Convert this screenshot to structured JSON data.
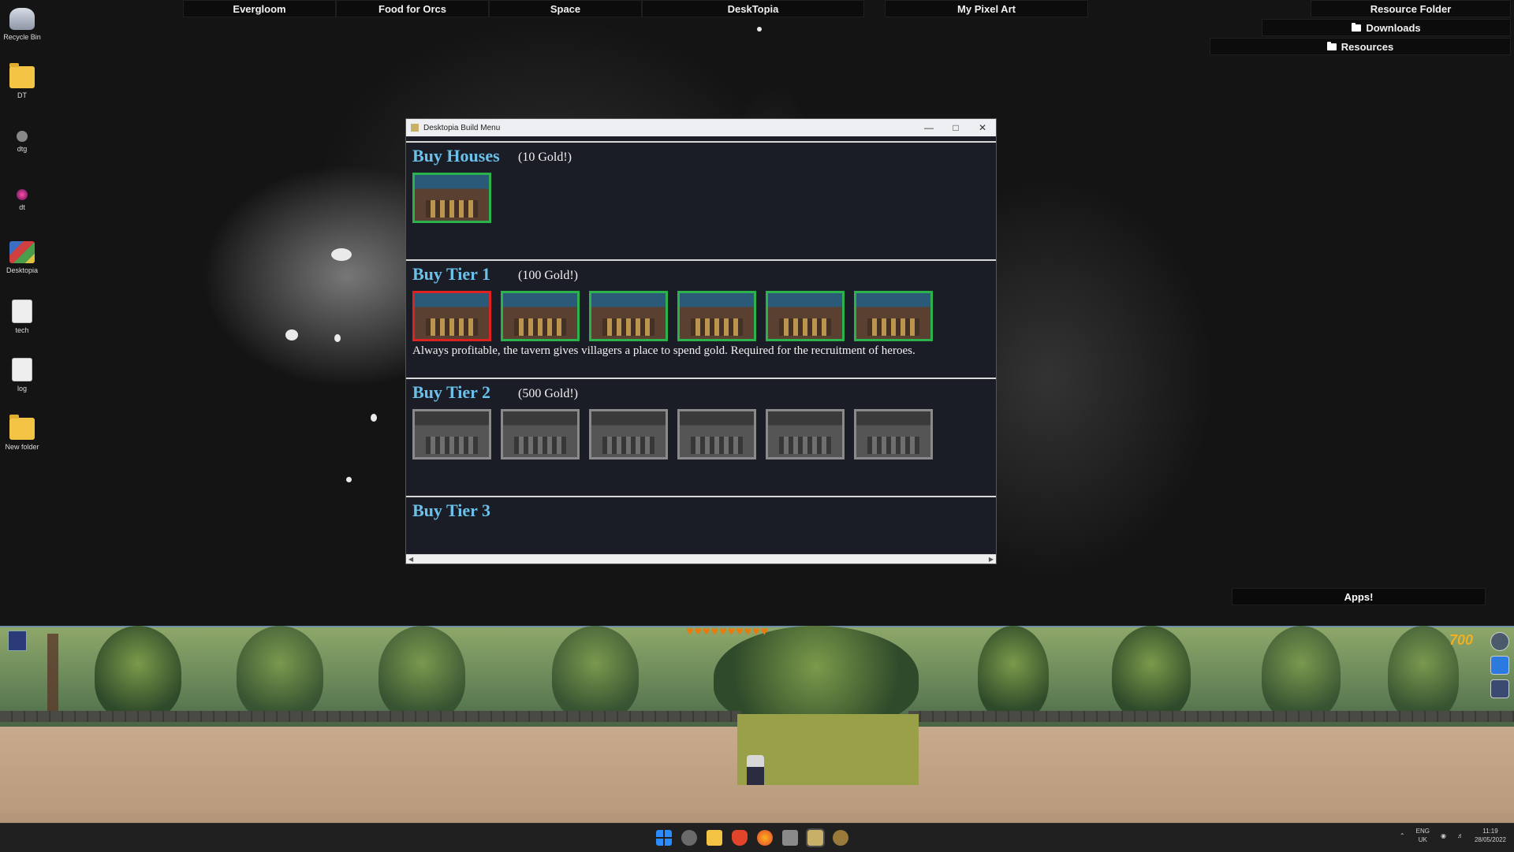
{
  "top_bar": {
    "tabs": [
      "Evergloom",
      "Food for Orcs",
      "Space",
      "DeskTopia"
    ],
    "pixel_art": "My Pixel Art",
    "resource_folder": "Resource Folder",
    "downloads": "Downloads",
    "resources": "Resources"
  },
  "desktop_icons": [
    {
      "label": "Recycle Bin",
      "icon": "recycle-bin-icon"
    },
    {
      "label": "DT",
      "icon": "folder-icon"
    },
    {
      "label": "dtg",
      "icon": "app-icon"
    },
    {
      "label": "dt",
      "icon": "app-icon"
    },
    {
      "label": "Desktopia",
      "icon": "archive-icon"
    },
    {
      "label": "tech",
      "icon": "document-icon"
    },
    {
      "label": "log",
      "icon": "document-icon"
    },
    {
      "label": "New folder",
      "icon": "folder-icon"
    }
  ],
  "window": {
    "title": "Desktopia Build Menu",
    "sections": [
      {
        "title": "Buy Houses",
        "price": "(10 Gold!)",
        "tiles": 1
      },
      {
        "title": "Buy Tier 1",
        "price": "(100 Gold!)",
        "tiles": 6,
        "description": "Always profitable, the tavern gives villagers a place to spend gold. Required for the recruitment of heroes."
      },
      {
        "title": "Buy Tier 2",
        "price": "(500 Gold!)",
        "tiles": 6
      },
      {
        "title": "Buy Tier 3",
        "price": "",
        "tiles": 0
      }
    ]
  },
  "apps_button": "Apps!",
  "game": {
    "hearts": 10,
    "gold": "700"
  },
  "taskbar": {
    "lang": "ENG",
    "region": "UK",
    "time": "11:19",
    "date": "28/05/2022"
  },
  "colors": {
    "section_title": "#6cc1ea",
    "tile_owned": "#2bb24c",
    "tile_selected": "#dd2222",
    "tile_locked": "#8a8a8a",
    "gold": "#f0b020"
  }
}
